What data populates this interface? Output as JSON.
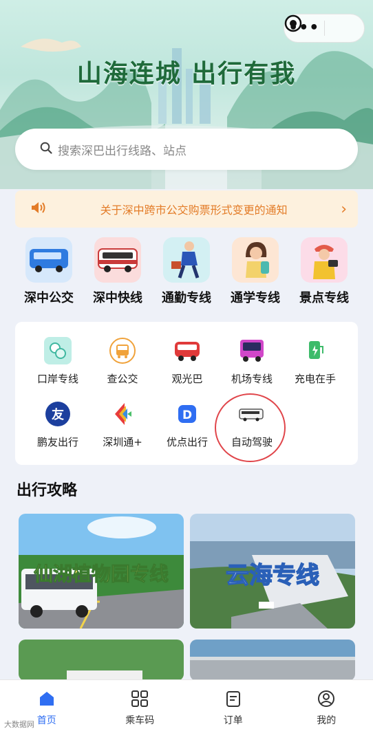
{
  "capsule": {
    "more_icon": "more-dots-icon",
    "close_icon": "miniprogram-target-icon"
  },
  "banner": {
    "title": "山海连城 出行有我"
  },
  "search": {
    "placeholder": "搜索深巴出行线路、站点"
  },
  "notice": {
    "text": "关于深中跨市公交购票形式变更的通知"
  },
  "categories": [
    {
      "label": "深中公交",
      "icon": "blue-bus-icon"
    },
    {
      "label": "深中快线",
      "icon": "red-bus-icon"
    },
    {
      "label": "通勤专线",
      "icon": "commuter-icon"
    },
    {
      "label": "通学专线",
      "icon": "student-icon"
    },
    {
      "label": "景点专线",
      "icon": "tourist-icon"
    }
  ],
  "services": [
    {
      "label": "口岸专线",
      "icon": "port-icon"
    },
    {
      "label": "查公交",
      "icon": "bus-lookup-icon"
    },
    {
      "label": "观光巴",
      "icon": "sightseeing-bus-icon"
    },
    {
      "label": "机场专线",
      "icon": "airport-bus-icon"
    },
    {
      "label": "充电在手",
      "icon": "charging-icon"
    },
    {
      "label": "鹏友出行",
      "icon": "pengyou-icon"
    },
    {
      "label": "深圳通+",
      "icon": "shenzhentong-icon"
    },
    {
      "label": "优点出行",
      "icon": "youdian-icon"
    },
    {
      "label": "自动驾驶",
      "icon": "autonomous-bus-icon"
    }
  ],
  "guide": {
    "title": "出行攻略",
    "cards": [
      {
        "label": "仙湖植物园专线"
      },
      {
        "label": "云海专线"
      }
    ]
  },
  "tabs": [
    {
      "label": "首页",
      "icon": "home-icon",
      "active": true
    },
    {
      "label": "乘车码",
      "icon": "qr-code-icon",
      "active": false
    },
    {
      "label": "订单",
      "icon": "order-icon",
      "active": false
    },
    {
      "label": "我的",
      "icon": "profile-icon",
      "active": false
    }
  ],
  "colors": {
    "accent": "#2f6ef2",
    "notice": "#e37c28",
    "highlight_circle": "#e0454a"
  },
  "watermark": "大数据网"
}
